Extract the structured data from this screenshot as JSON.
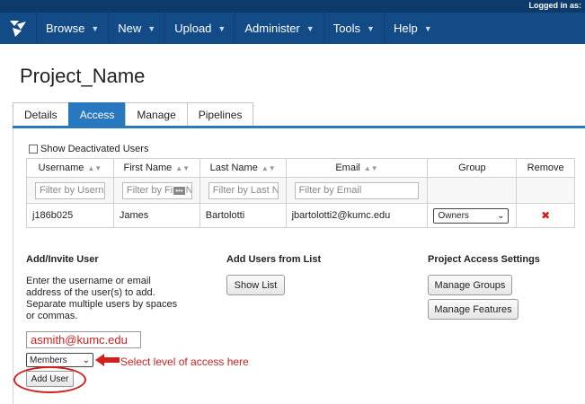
{
  "header": {
    "logged_in": "Logged in as:"
  },
  "nav": {
    "items": [
      {
        "label": "Browse"
      },
      {
        "label": "New"
      },
      {
        "label": "Upload"
      },
      {
        "label": "Administer"
      },
      {
        "label": "Tools"
      },
      {
        "label": "Help"
      }
    ]
  },
  "page": {
    "title": "Project_Name"
  },
  "tabs": [
    {
      "label": "Details",
      "active": false
    },
    {
      "label": "Access",
      "active": true
    },
    {
      "label": "Manage",
      "active": false
    },
    {
      "label": "Pipelines",
      "active": false
    }
  ],
  "access": {
    "show_deactivated_label": "Show Deactivated Users",
    "columns": [
      "Username",
      "First Name",
      "Last Name",
      "Email",
      "Group",
      "Remove"
    ],
    "filters": {
      "username": "Filter by Userna",
      "first_name": "Filter by Fi",
      "first_name_tail": "N",
      "last_name": "Filter by Last N",
      "email": "Filter by Email"
    },
    "rows": [
      {
        "username": "j186b025",
        "first_name": "James",
        "last_name": "Bartolotti",
        "email": "jbartolotti2@kumc.edu",
        "group": "Owners"
      }
    ]
  },
  "add_invite": {
    "heading": "Add/Invite User",
    "description": "Enter the username or email address of the user(s) to add. Separate multiple users by spaces or commas.",
    "input_value": "asmith@kumc.edu",
    "level_value": "Members",
    "annotation": "Select level of access here",
    "add_button": "Add User"
  },
  "add_from_list": {
    "heading": "Add Users from List",
    "button": "Show List"
  },
  "settings": {
    "heading": "Project Access Settings",
    "manage_groups": "Manage Groups",
    "manage_features": "Manage Features"
  },
  "colors": {
    "nav": "#134b87",
    "active_tab": "#2878c0",
    "annotation": "#d02020"
  }
}
